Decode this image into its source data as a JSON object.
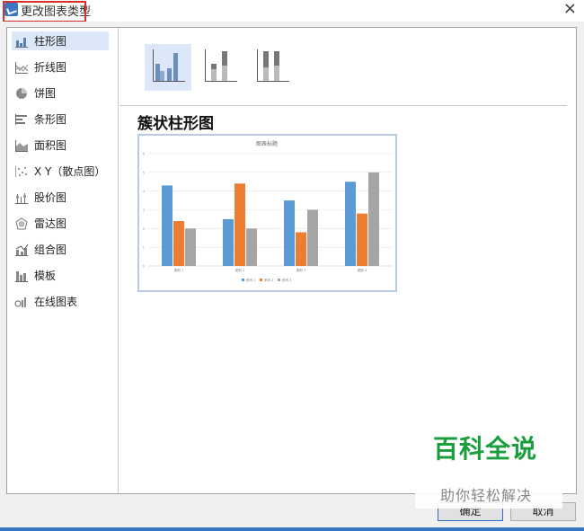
{
  "window": {
    "title": "更改图表类型",
    "close_label": "×"
  },
  "sidebar": {
    "items": [
      {
        "label": "柱形图"
      },
      {
        "label": "折线图"
      },
      {
        "label": "饼图"
      },
      {
        "label": "条形图"
      },
      {
        "label": "面积图"
      },
      {
        "label": "X Y（散点图）"
      },
      {
        "label": "股价图"
      },
      {
        "label": "雷达图"
      },
      {
        "label": "组合图"
      },
      {
        "label": "模板"
      },
      {
        "label": "在线图表"
      }
    ],
    "selected_index": 0
  },
  "main": {
    "variants": [
      "clustered-column",
      "stacked-column",
      "percent-stacked-column"
    ],
    "selected_variant": 0,
    "chart_heading": "簇状柱形图"
  },
  "preview": {
    "chart_title": "图表标题",
    "categories": [
      "类别 1",
      "类别 2",
      "类别 3",
      "类别 4"
    ],
    "legend": [
      "系列 1",
      "系列 2",
      "系列 3"
    ],
    "series_colors": [
      "#5b9bd5",
      "#ed7d31",
      "#a5a5a5"
    ],
    "values": [
      [
        4.3,
        2.4,
        2.0
      ],
      [
        2.5,
        4.4,
        2.0
      ],
      [
        3.5,
        1.8,
        3.0
      ],
      [
        4.5,
        2.8,
        5.0
      ]
    ],
    "y_ticks": [
      "0",
      "1",
      "2",
      "3",
      "4",
      "5",
      "6"
    ]
  },
  "buttons": {
    "ok_label": "确定",
    "cancel_label": "取消"
  },
  "watermark": {
    "title": "百科全说",
    "subtitle": "助你轻松解决"
  }
}
